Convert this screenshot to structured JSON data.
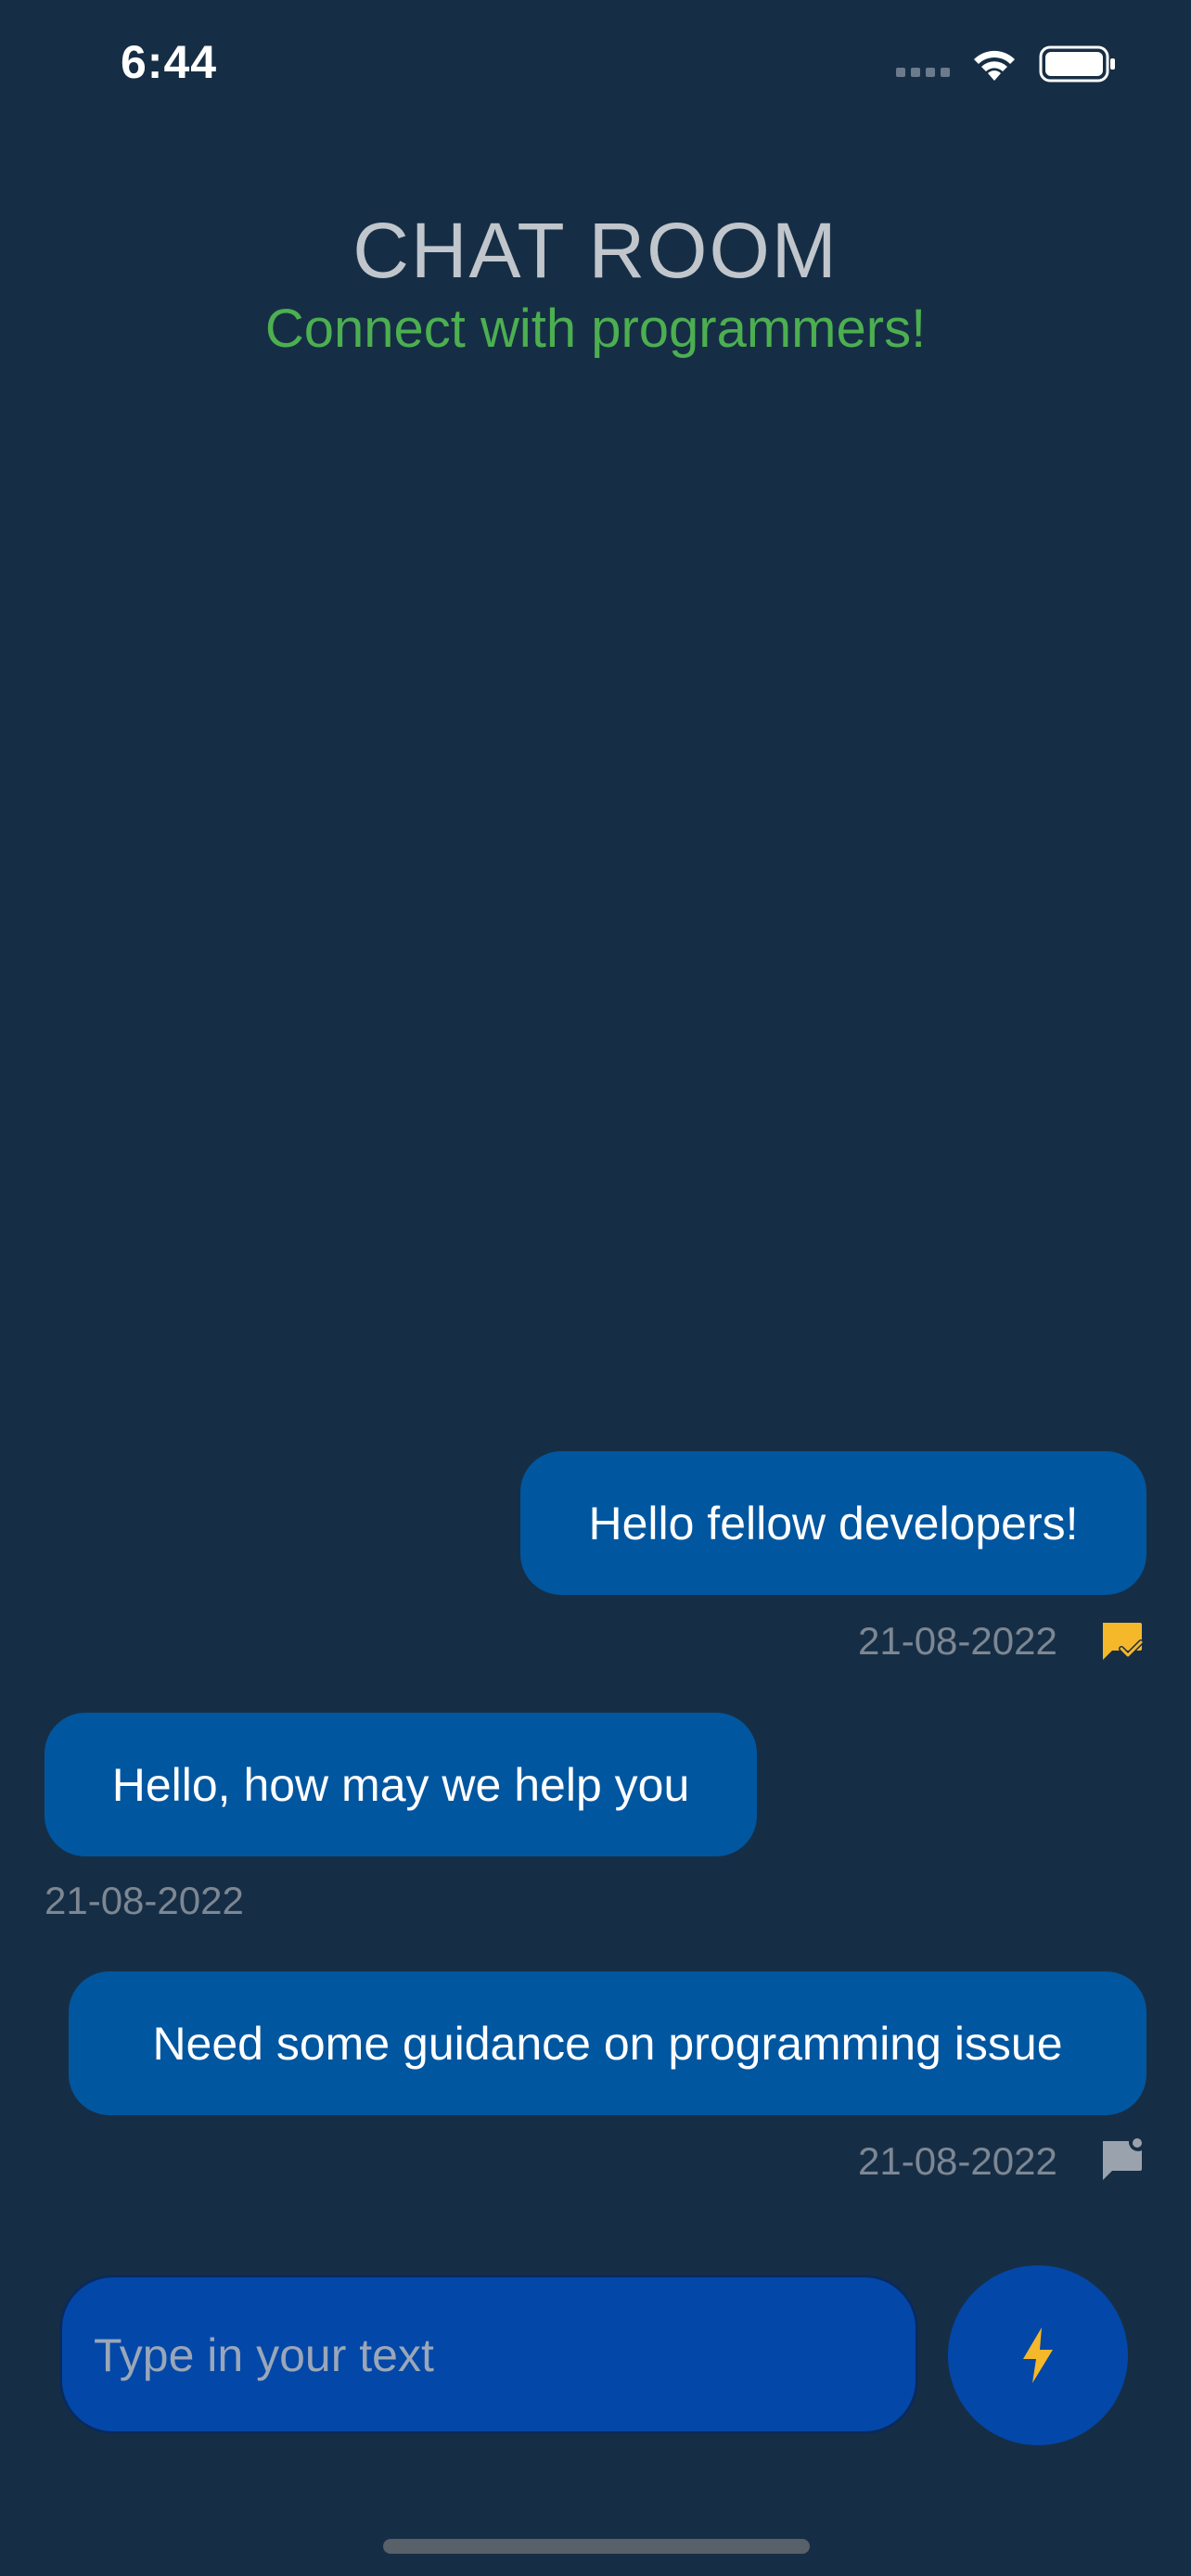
{
  "status_bar": {
    "time": "6:44"
  },
  "header": {
    "title": "CHAT ROOM",
    "subtitle": "Connect with programmers!"
  },
  "messages": [
    {
      "text": "Hello fellow developers!",
      "date": "21-08-2022",
      "side": "right",
      "status_icon": "read-check-icon"
    },
    {
      "text": "Hello, how may we help you",
      "date": "21-08-2022",
      "side": "left"
    },
    {
      "text": "Need some guidance on programming issue",
      "date": "21-08-2022",
      "side": "right",
      "status_icon": "sent-message-icon"
    }
  ],
  "composer": {
    "placeholder": "Type in your text",
    "send_icon": "lightning-bolt-icon"
  },
  "colors": {
    "background": "#162e45",
    "bubble": "#0156a0",
    "accent_green": "#4caf50",
    "accent_yellow": "#f5b82a",
    "input_bg": "#0347a8"
  }
}
